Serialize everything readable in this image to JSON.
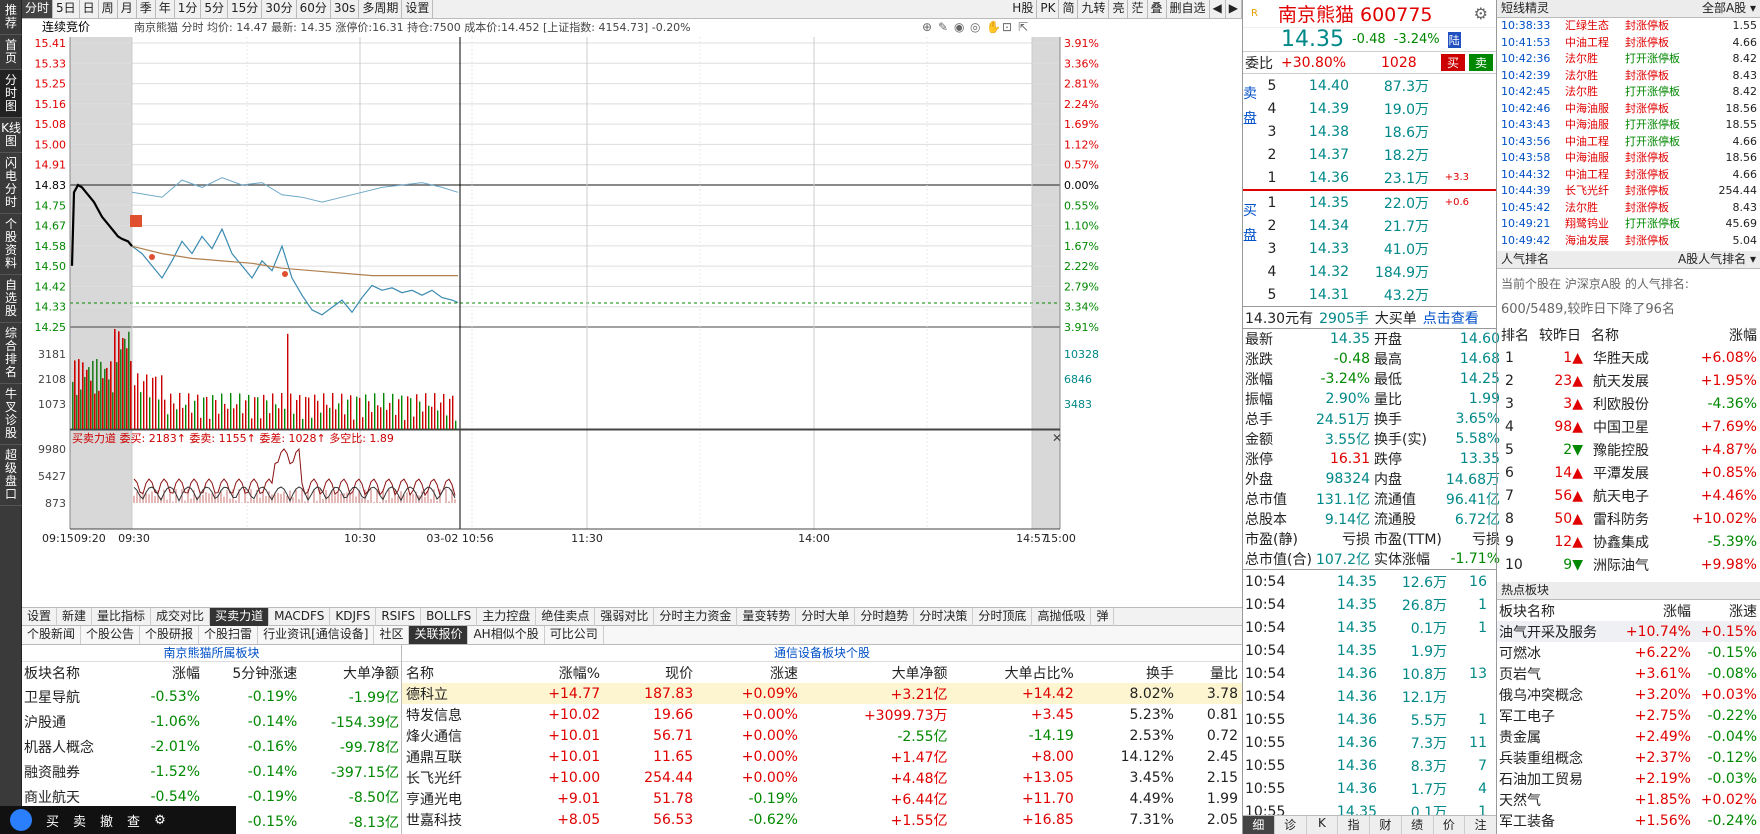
{
  "leftnav": [
    "推荐",
    "首页",
    "分时图",
    "K线图",
    "闪电分时",
    "个股资料",
    "自选股",
    "综合排名",
    "牛叉诊股",
    "超级盘口"
  ],
  "toolbar": {
    "left": [
      "分时",
      "5日",
      "日",
      "周",
      "月",
      "季",
      "年",
      "1分",
      "5分",
      "15分",
      "30分",
      "60分",
      "30s",
      "多周期",
      "设置"
    ],
    "right": [
      "H股",
      "PK",
      "简",
      "九转",
      "亮",
      "茫",
      "叠",
      "删自选"
    ]
  },
  "chart": {
    "header": "连续竞价",
    "info": "南京熊猫 分时 均价: 14.47 最新: 14.35 涨停价:16.31 持仓:7500 成本价:14.452 [上证指数: 4154.73] -0.20%",
    "price_ticks": [
      "15.41",
      "15.33",
      "15.25",
      "15.16",
      "15.08",
      "15.00",
      "14.91",
      "14.83",
      "14.75",
      "14.67",
      "14.58",
      "14.50",
      "14.42",
      "14.33",
      "14.25"
    ],
    "pct_ticks": [
      "3.91%",
      "3.36%",
      "2.81%",
      "2.24%",
      "1.69%",
      "1.12%",
      "0.57%",
      "0.00%",
      "0.55%",
      "1.10%",
      "1.67%",
      "2.22%",
      "2.79%",
      "3.34%",
      "3.91%"
    ],
    "vol_ticks_left": [
      "3181",
      "2108",
      "1073"
    ],
    "vol_ticks_right": [
      "10328",
      "6846",
      "3483"
    ],
    "force_header": "买卖力道 委买: 2183↑ 委卖: 1155↑ 委差: 1028↑ 多空比: 1.89",
    "force_ticks": [
      "9980",
      "5427",
      "873"
    ],
    "time_ticks": [
      "09:15",
      "09:20",
      "09:30",
      "10:30",
      "03-02 10:56",
      "11:30",
      "14:00",
      "14:57",
      "15:00"
    ]
  },
  "indtabs": [
    "设置",
    "新建",
    "量比指标",
    "成交对比",
    "买卖力道",
    "MACDFS",
    "KDJFS",
    "RSIFS",
    "BOLLFS",
    "主力控盘",
    "绝佳卖点",
    "强弱对比",
    "分时主力资金",
    "量变转势",
    "分时大单",
    "分时趋势",
    "分时决策",
    "分时顶底",
    "高抛低吸",
    "弹"
  ],
  "infotabs": [
    "个股新闻",
    "个股公告",
    "个股研报",
    "个股扫雷",
    "行业资讯[通信设备]",
    "社区",
    "关联报价",
    "AH相似个股",
    "可比公司"
  ],
  "sector": {
    "title": "南京熊猫所属板块",
    "cols": [
      "板块名称",
      "涨幅",
      "5分钟涨速",
      "大单净额"
    ],
    "rows": [
      [
        "卫星导航",
        "-0.53%",
        "-0.19%",
        "-1.99亿"
      ],
      [
        "沪股通",
        "-1.06%",
        "-0.14%",
        "-154.39亿"
      ],
      [
        "机器人概念",
        "-2.01%",
        "-0.16%",
        "-99.78亿"
      ],
      [
        "融资融券",
        "-1.52%",
        "-0.14%",
        "-397.15亿"
      ],
      [
        "商业航天",
        "-0.54%",
        "-0.19%",
        "-8.50亿"
      ],
      [
        "",
        "",
        "-0.15%",
        "-8.13亿"
      ]
    ]
  },
  "stocks": {
    "title": "通信设备板块个股",
    "cols": [
      "名称",
      "涨幅%",
      "现价",
      "涨速",
      "大单净额",
      "大单占比%",
      "换手",
      "量比"
    ],
    "rows": [
      [
        "德科立",
        "+14.77",
        "187.83",
        "+0.09%",
        "+3.21亿",
        "+14.42",
        "8.02%",
        "3.78"
      ],
      [
        "特发信息",
        "+10.02",
        "19.66",
        "+0.00%",
        "+3099.73万",
        "+3.45",
        "5.23%",
        "0.81"
      ],
      [
        "烽火通信",
        "+10.01",
        "56.71",
        "+0.00%",
        "-2.55亿",
        "-14.19",
        "2.53%",
        "0.72"
      ],
      [
        "通鼎互联",
        "+10.01",
        "11.65",
        "+0.00%",
        "+1.47亿",
        "+8.00",
        "14.12%",
        "2.45"
      ],
      [
        "长飞光纤",
        "+10.00",
        "254.44",
        "+0.00%",
        "+4.48亿",
        "+13.05",
        "3.45%",
        "2.15"
      ],
      [
        "亨通光电",
        "+9.01",
        "51.78",
        "-0.19%",
        "+6.44亿",
        "+11.70",
        "4.49%",
        "1.99"
      ],
      [
        "世嘉科技",
        "+8.05",
        "56.53",
        "-0.62%",
        "+1.55亿",
        "+16.85",
        "7.31%",
        "2.05"
      ]
    ]
  },
  "quote": {
    "name": "南京熊猫 600775",
    "price": "14.35",
    "chg": "-0.48",
    "pct": "-3.24%",
    "tag": "陆",
    "weibi_label": "委比",
    "weibi": "+30.80%",
    "weicha": "1028",
    "buy": "买",
    "sell": "卖",
    "sell_label": "卖盘",
    "buy_label": "买盘",
    "asks": [
      [
        "5",
        "14.40",
        "87.3万",
        ""
      ],
      [
        "4",
        "14.39",
        "19.0万",
        ""
      ],
      [
        "3",
        "14.38",
        "18.6万",
        ""
      ],
      [
        "2",
        "14.37",
        "18.2万",
        ""
      ],
      [
        "1",
        "14.36",
        "23.1万",
        "+3.3"
      ]
    ],
    "bids": [
      [
        "1",
        "14.35",
        "22.0万",
        "+0.6"
      ],
      [
        "2",
        "14.34",
        "21.7万",
        ""
      ],
      [
        "3",
        "14.33",
        "41.0万",
        ""
      ],
      [
        "4",
        "14.32",
        "184.9万",
        ""
      ],
      [
        "5",
        "14.31",
        "43.2万",
        ""
      ]
    ],
    "bigorder": [
      "14.30元有",
      "2905手",
      "大买单",
      "点击查看"
    ],
    "stats": [
      [
        "最新",
        "14.35",
        "开盘",
        "14.60"
      ],
      [
        "涨跌",
        "-0.48",
        "最高",
        "14.68"
      ],
      [
        "涨幅",
        "-3.24%",
        "最低",
        "14.25"
      ],
      [
        "振幅",
        "2.90%",
        "量比",
        "1.99"
      ],
      [
        "总手",
        "24.51万",
        "换手",
        "3.65%"
      ],
      [
        "金额",
        "3.55亿",
        "换手(实)",
        "5.58%"
      ],
      [
        "涨停",
        "16.31",
        "跌停",
        "13.35"
      ],
      [
        "外盘",
        "98324",
        "内盘",
        "14.68万"
      ],
      [
        "总市值",
        "131.1亿",
        "流通值",
        "96.41亿"
      ],
      [
        "总股本",
        "9.14亿",
        "流通股",
        "6.72亿"
      ],
      [
        "市盈(静)",
        "亏损",
        "市盈(TTM)",
        "亏损"
      ],
      [
        "总市值(合)",
        "107.2亿",
        "实体涨幅",
        "-1.71%"
      ]
    ],
    "ticks": [
      [
        "10:54",
        "14.35",
        "12.6万",
        "16"
      ],
      [
        "10:54",
        "14.35",
        "26.8万",
        "1"
      ],
      [
        "10:54",
        "14.35",
        "0.1万",
        "1"
      ],
      [
        "10:54",
        "14.35",
        "1.9万",
        ""
      ],
      [
        "10:54",
        "14.36",
        "10.8万",
        "13"
      ],
      [
        "10:54",
        "14.36",
        "12.1万",
        ""
      ],
      [
        "10:55",
        "14.36",
        "5.5万",
        "1"
      ],
      [
        "10:55",
        "14.36",
        "7.3万",
        "11"
      ],
      [
        "10:55",
        "14.36",
        "8.3万",
        "7"
      ],
      [
        "10:55",
        "14.36",
        "1.7万",
        "4"
      ],
      [
        "10:55",
        "14.35",
        "0.1万",
        "1"
      ]
    ],
    "bottom_tabs": [
      "细",
      "诊",
      "K",
      "指",
      "财",
      "绩",
      "价",
      "注"
    ]
  },
  "alerts": {
    "title": "短线精灵",
    "filter": "全部A股",
    "rows": [
      [
        "10:38:33",
        "汇绿生态",
        "封涨停板",
        "1.55"
      ],
      [
        "10:41:53",
        "中油工程",
        "封涨停板",
        "4.66"
      ],
      [
        "10:42:36",
        "法尔胜",
        "打开涨停板",
        "8.42"
      ],
      [
        "10:42:39",
        "法尔胜",
        "封涨停板",
        "8.43"
      ],
      [
        "10:42:45",
        "法尔胜",
        "打开涨停板",
        "8.42"
      ],
      [
        "10:42:46",
        "中海油服",
        "封涨停板",
        "18.56"
      ],
      [
        "10:43:43",
        "中海油服",
        "打开涨停板",
        "18.55"
      ],
      [
        "10:43:56",
        "中油工程",
        "打开涨停板",
        "4.66"
      ],
      [
        "10:43:58",
        "中海油服",
        "封涨停板",
        "18.56"
      ],
      [
        "10:44:32",
        "中油工程",
        "封涨停板",
        "4.66"
      ],
      [
        "10:44:39",
        "长飞光纤",
        "封涨停板",
        "254.44"
      ],
      [
        "10:45:42",
        "法尔胜",
        "封涨停板",
        "8.43"
      ],
      [
        "10:49:21",
        "翔鹭钨业",
        "打开涨停板",
        "45.69"
      ],
      [
        "10:49:42",
        "海油发展",
        "封涨停板",
        "5.04"
      ]
    ]
  },
  "hot": {
    "title": "人气排名",
    "filter": "A股人气排名",
    "line1": "当前个股在 沪深京A股 的人气排名:",
    "line2": "600/5489,较昨日下降了96名",
    "cols": [
      "排名",
      "较昨日",
      "名称",
      "涨幅"
    ],
    "rows": [
      [
        "1",
        "1",
        "华胜天成",
        "+6.08%"
      ],
      [
        "2",
        "23",
        "航天发展",
        "+1.95%"
      ],
      [
        "3",
        "3",
        "利欧股份",
        "-4.36%"
      ],
      [
        "4",
        "98",
        "中国卫星",
        "+7.69%"
      ],
      [
        "5",
        "2",
        "豫能控股",
        "+4.87%"
      ],
      [
        "6",
        "14",
        "平潭发展",
        "+0.85%"
      ],
      [
        "7",
        "56",
        "航天电子",
        "+4.46%"
      ],
      [
        "8",
        "50",
        "雷科防务",
        "+10.02%"
      ],
      [
        "9",
        "12",
        "协鑫集成",
        "-5.39%"
      ],
      [
        "10",
        "9",
        "洲际油气",
        "+9.98%"
      ]
    ],
    "dir": [
      "up",
      "up",
      "up",
      "up",
      "down",
      "up",
      "up",
      "up",
      "up",
      "down"
    ]
  },
  "hotsect": {
    "title": "热点板块",
    "cols": [
      "板块名称",
      "涨幅",
      "涨速"
    ],
    "rows": [
      [
        "油气开采及服务",
        "+10.74%",
        "+0.15%"
      ],
      [
        "可燃冰",
        "+6.22%",
        "-0.15%"
      ],
      [
        "页岩气",
        "+3.61%",
        "-0.08%"
      ],
      [
        "俄乌冲突概念",
        "+3.20%",
        "+0.03%"
      ],
      [
        "军工电子",
        "+2.75%",
        "-0.22%"
      ],
      [
        "贵金属",
        "+2.49%",
        "-0.04%"
      ],
      [
        "兵装重组概念",
        "+2.37%",
        "-0.12%"
      ],
      [
        "石油加工贸易",
        "+2.19%",
        "-0.03%"
      ],
      [
        "天然气",
        "+1.85%",
        "+0.02%"
      ],
      [
        "军工装备",
        "+1.56%",
        "-0.24%"
      ]
    ]
  },
  "bottombar": [
    "买",
    "卖",
    "撤",
    "查"
  ]
}
